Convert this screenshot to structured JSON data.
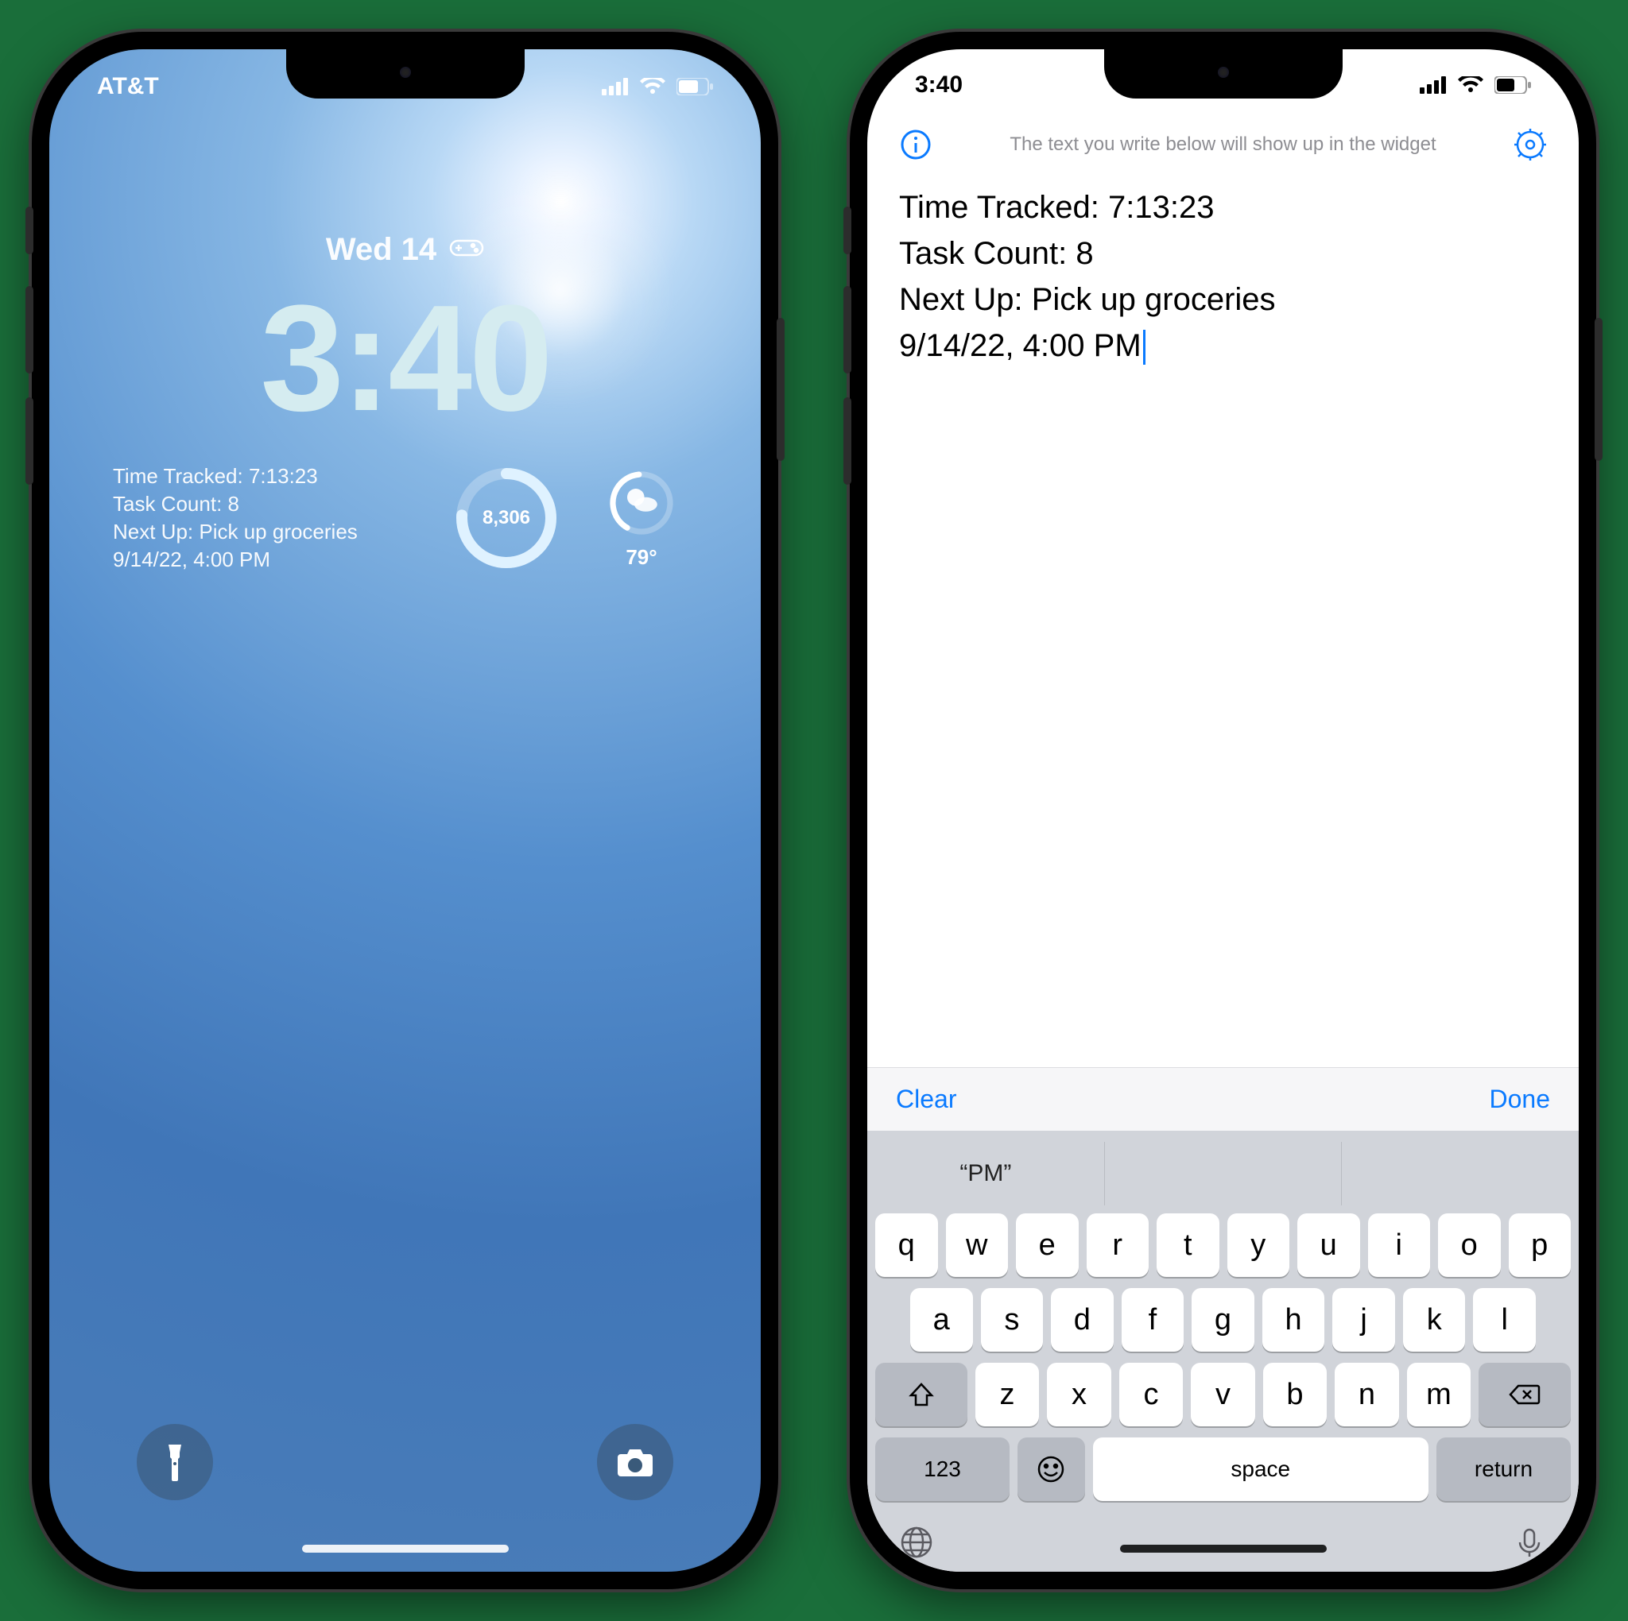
{
  "left": {
    "carrier": "AT&T",
    "date": "Wed 14",
    "time": "3:40",
    "widget_lines": [
      "Time Tracked: 7:13:23",
      "Task Count: 8",
      "Next Up: Pick up groceries",
      "9/14/22, 4:00 PM"
    ],
    "ring_value": "8,306",
    "temperature": "79°"
  },
  "right": {
    "status_time": "3:40",
    "hint": "The text you write below will show up in the widget",
    "note_lines": [
      "Time Tracked: 7:13:23",
      "Task Count: 8",
      "Next Up: Pick up groceries",
      "9/14/22, 4:00 PM"
    ],
    "accessory": {
      "clear": "Clear",
      "done": "Done"
    },
    "suggestion": "“PM”",
    "keyboard": {
      "row1": [
        "q",
        "w",
        "e",
        "r",
        "t",
        "y",
        "u",
        "i",
        "o",
        "p"
      ],
      "row2": [
        "a",
        "s",
        "d",
        "f",
        "g",
        "h",
        "j",
        "k",
        "l"
      ],
      "row3": [
        "z",
        "x",
        "c",
        "v",
        "b",
        "n",
        "m"
      ],
      "num_label": "123",
      "space_label": "space",
      "return_label": "return"
    }
  }
}
